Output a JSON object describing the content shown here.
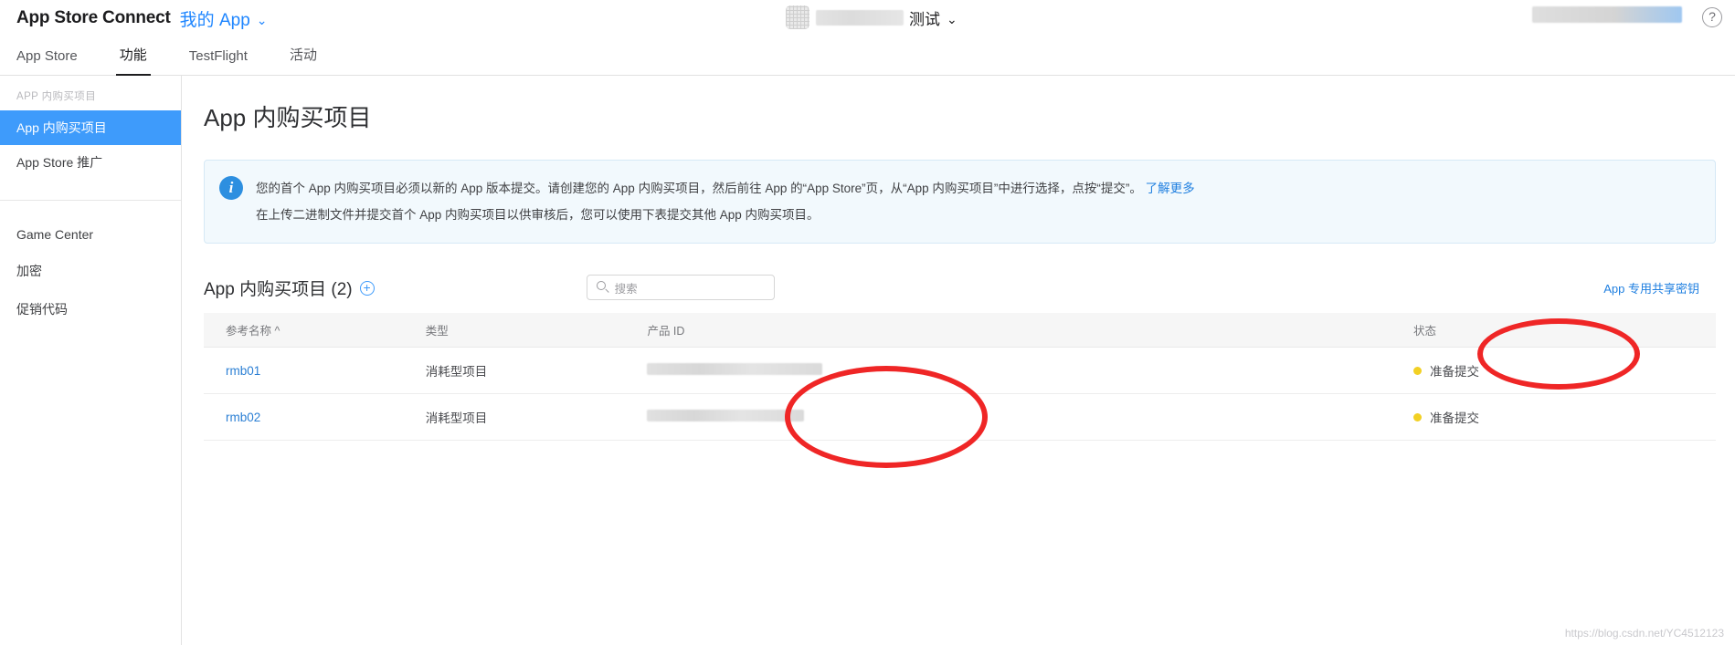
{
  "header": {
    "brand": "App Store Connect",
    "my_app_label": "我的 App",
    "chevron": "⌄",
    "app_title_suffix": "测试",
    "help_label": "?"
  },
  "tabs": [
    {
      "label": "App Store",
      "active": false
    },
    {
      "label": "功能",
      "active": true
    },
    {
      "label": "TestFlight",
      "active": false
    },
    {
      "label": "活动",
      "active": false
    }
  ],
  "sidebar": {
    "group_title": "APP 内购买项目",
    "items": [
      {
        "label": "App 内购买项目",
        "active": true
      },
      {
        "label": "App Store 推广",
        "active": false
      }
    ],
    "secondary_items": [
      {
        "label": "Game Center"
      },
      {
        "label": "加密"
      },
      {
        "label": "促销代码"
      }
    ]
  },
  "main": {
    "page_title": "App 内购买项目",
    "notice": {
      "icon": "info-icon",
      "line1_before_link": "您的首个 App 内购买项目必须以新的 App 版本提交。请创建您的 App 内购买项目，然后前往 App 的“App Store”页，从“App 内购买项目”中进行选择，点按“提交”。",
      "line1_link": "了解更多",
      "line2": "在上传二进制文件并提交首个 App 内购买项目以供审核后，您可以使用下表提交其他 App 内购买项目。"
    },
    "list_title": "App 内购买项目 (2)",
    "add_icon": "+",
    "search_placeholder": "搜索",
    "shared_secret_link": "App 专用共享密钥",
    "table": {
      "columns": [
        "参考名称 ^",
        "类型",
        "产品 ID",
        "状态"
      ],
      "rows": [
        {
          "name": "rmb01",
          "type": "消耗型项目",
          "product_id": "",
          "status": "准备提交",
          "status_color": "#f2d024"
        },
        {
          "name": "rmb02",
          "type": "消耗型项目",
          "product_id": "",
          "status": "准备提交",
          "status_color": "#f2d024"
        }
      ]
    }
  },
  "annotations": {
    "color": "#ef2626",
    "ellipse_product_id": "product-id-column-highlight",
    "ellipse_shared_secret": "shared-secret-link-highlight"
  },
  "watermark": "https://blog.csdn.net/YC4512123"
}
